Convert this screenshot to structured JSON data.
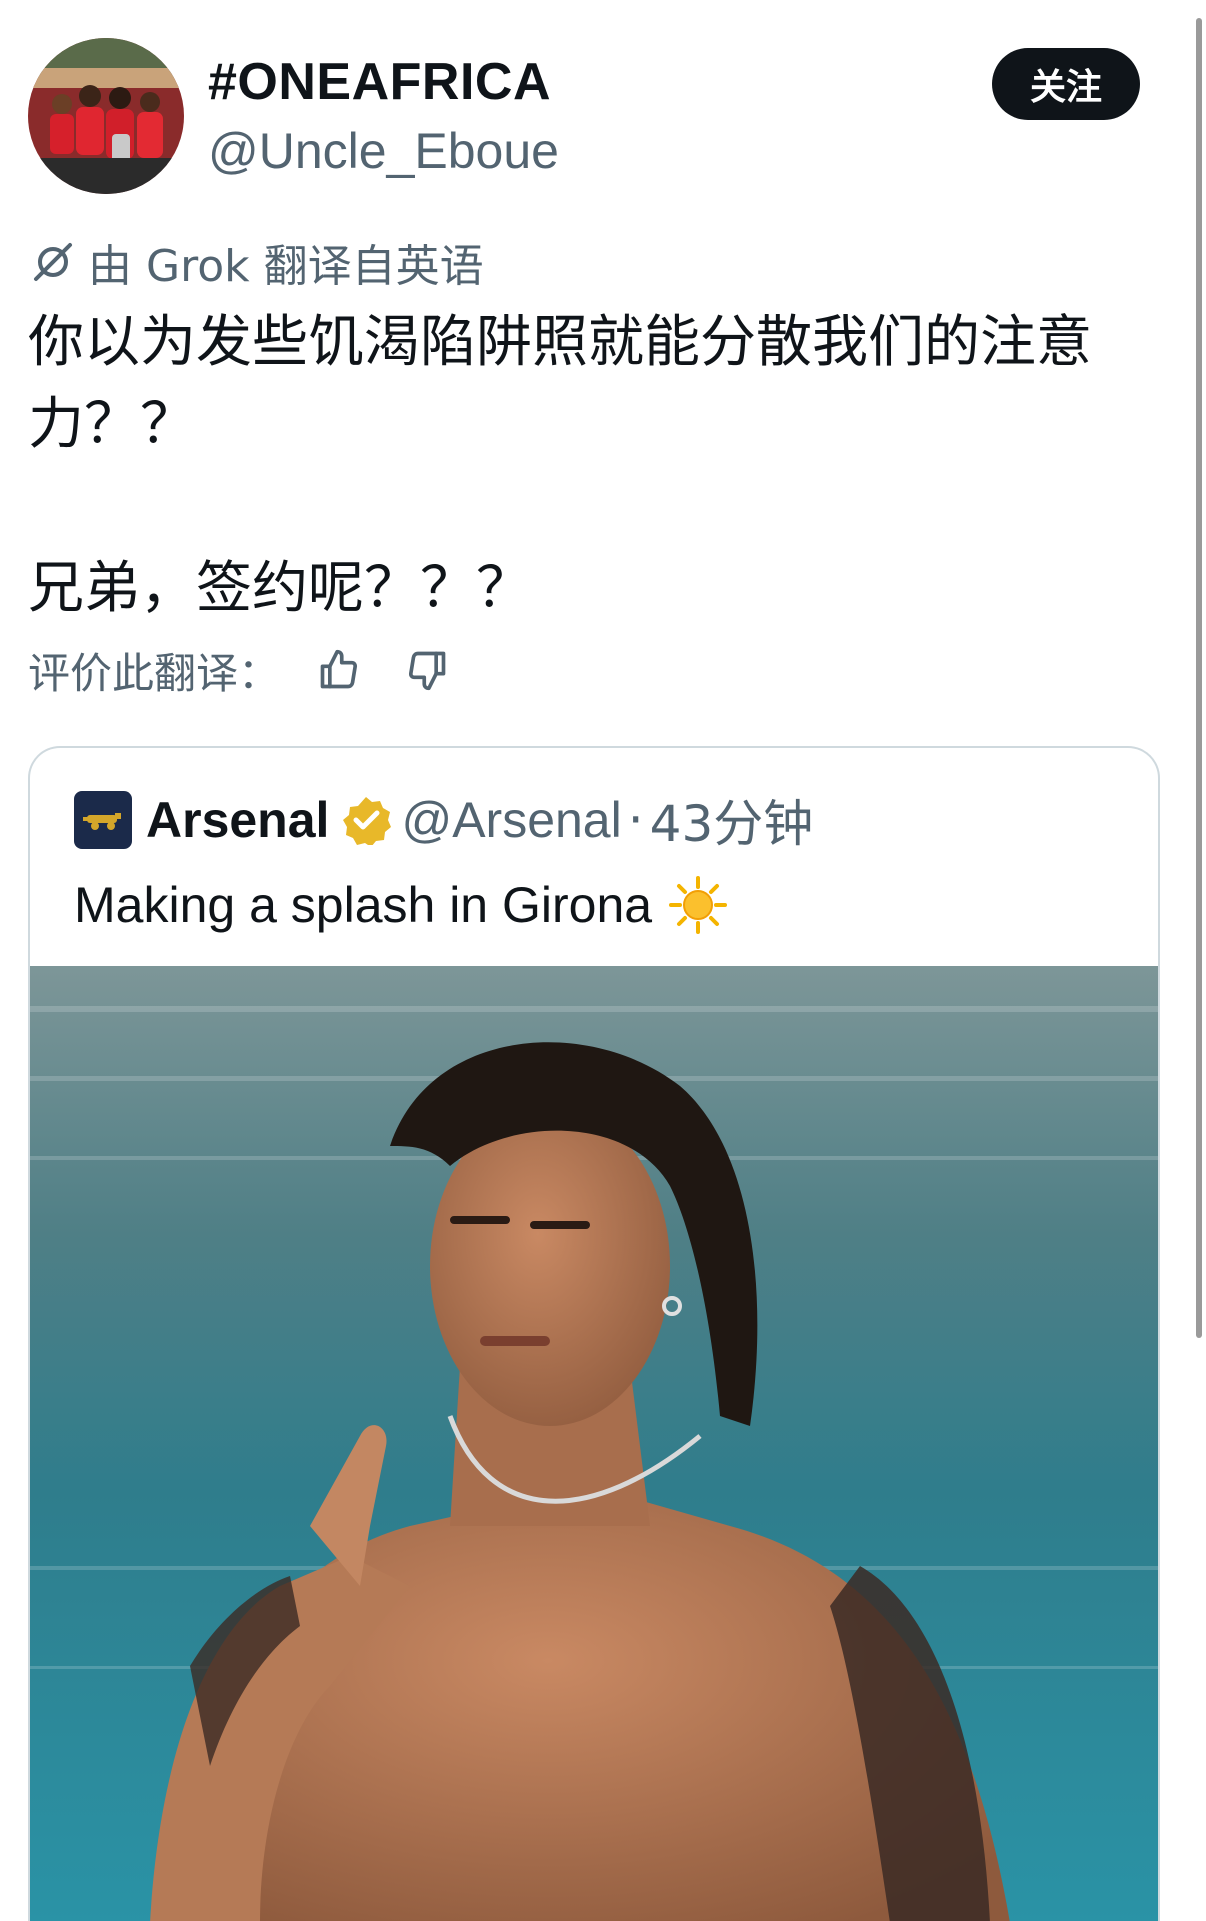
{
  "author": {
    "display_name": "#ONEAFRICA",
    "handle": "@Uncle_Eboue",
    "follow_label": "关注"
  },
  "translation": {
    "translated_by": "由 Grok 翻译自英语",
    "rate_label": "评价此翻译："
  },
  "tweet": {
    "line1": "你以为发些饥渴陷阱照就能分散我们的注意力？？",
    "line2": "兄弟，签约呢？？？"
  },
  "quote": {
    "name": "Arsenal",
    "handle": "@Arsenal",
    "separator": "·",
    "time": "43分钟",
    "text": "Making a splash in Girona",
    "media_alt": "Photo of a long-haired man with a necklace and tattooed arm pointing toward the camera while standing in a swimming pool"
  },
  "icons": {
    "grok": "grok-slash-icon",
    "thumbs_up": "thumbs-up-icon",
    "thumbs_down": "thumbs-down-icon",
    "verified": "verified-badge-icon",
    "emoji": "sun-emoji-icon"
  },
  "colors": {
    "text_primary": "#0f1419",
    "text_secondary": "#536471",
    "follow_button_bg": "#0f1419",
    "border": "#cfd9de",
    "verified_gold": "#e8b829"
  }
}
